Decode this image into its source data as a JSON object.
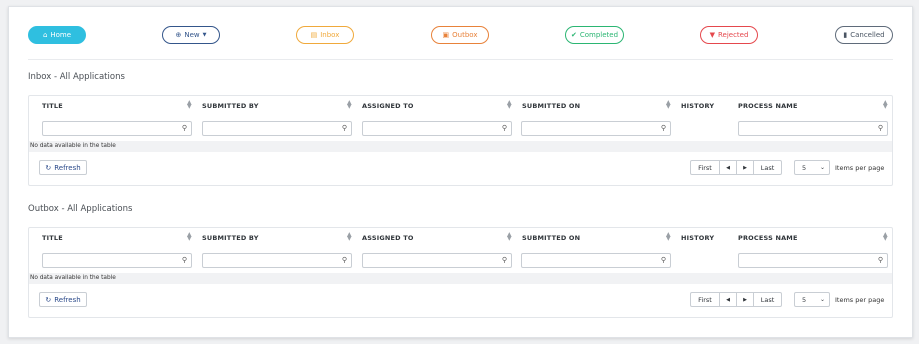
{
  "toolbar": {
    "home": {
      "label": "Home",
      "icon": "home-icon"
    },
    "new": {
      "label": "New",
      "icon": "plus-circle-icon"
    },
    "inbox": {
      "label": "Inbox",
      "icon": "inbox-icon"
    },
    "outbox": {
      "label": "Outbox",
      "icon": "outbox-icon"
    },
    "completed": {
      "label": "Completed",
      "icon": "check-circle-icon"
    },
    "rejected": {
      "label": "Rejected",
      "icon": "thumbs-down-icon"
    },
    "cancelled": {
      "label": "Cancelled",
      "icon": "trash-icon"
    }
  },
  "colors": {
    "home": "#2fbfe0",
    "new": "#34568b",
    "inbox": "#f0a93b",
    "outbox": "#e8823a",
    "completed": "#2bb673",
    "rejected": "#e5484d",
    "cancelled": "#5f6b7a"
  },
  "sections": [
    {
      "title": "Inbox - All Applications",
      "columns": [
        "TITLE",
        "SUBMITTED BY",
        "ASSIGNED TO",
        "SUBMITTED ON",
        "HISTORY",
        "PROCESS NAME"
      ],
      "empty_text": "No data available in the table",
      "refresh_label": "Refresh",
      "pager": {
        "first": "First",
        "last": "Last"
      },
      "per_page_value": "5",
      "per_page_label": "Items per page"
    },
    {
      "title": "Outbox - All Applications",
      "columns": [
        "TITLE",
        "SUBMITTED BY",
        "ASSIGNED TO",
        "SUBMITTED ON",
        "HISTORY",
        "PROCESS NAME"
      ],
      "empty_text": "No data available in the table",
      "refresh_label": "Refresh",
      "pager": {
        "first": "First",
        "last": "Last"
      },
      "per_page_value": "5",
      "per_page_label": "Items per page"
    }
  ]
}
